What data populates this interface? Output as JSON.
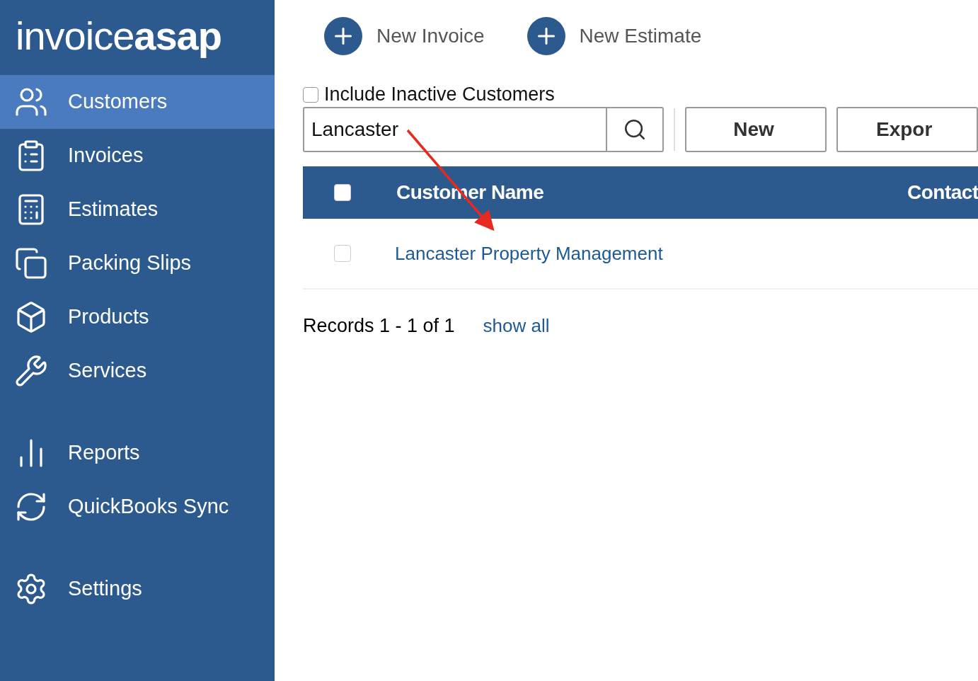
{
  "logo": {
    "light": "invoice",
    "bold": "asap"
  },
  "sidebar": {
    "sections": [
      {
        "items": [
          {
            "label": "Customers",
            "kind": "users",
            "selected": true
          },
          {
            "label": "Invoices",
            "kind": "clipboard",
            "selected": false
          },
          {
            "label": "Estimates",
            "kind": "calculator",
            "selected": false
          },
          {
            "label": "Packing Slips",
            "kind": "slips",
            "selected": false
          },
          {
            "label": "Products",
            "kind": "box",
            "selected": false
          },
          {
            "label": "Services",
            "kind": "wrench",
            "selected": false
          }
        ]
      },
      {
        "items": [
          {
            "label": "Reports",
            "kind": "chart",
            "selected": false
          },
          {
            "label": "QuickBooks Sync",
            "kind": "sync",
            "selected": false
          }
        ]
      },
      {
        "items": [
          {
            "label": "Settings",
            "kind": "gear",
            "selected": false
          }
        ]
      }
    ]
  },
  "actions": [
    "New Invoice",
    "New Estimate"
  ],
  "filter": {
    "label": "Include Inactive Customers",
    "checked": false
  },
  "search": {
    "value": "Lancaster"
  },
  "buttons": [
    "New",
    "Expor"
  ],
  "table": {
    "header_checked": false,
    "columns": [
      "Customer Name",
      "Contact"
    ],
    "rows": [
      {
        "name": "Lancaster Property Management",
        "checked": false
      }
    ]
  },
  "footer": {
    "records": "Records 1 - 1 of 1",
    "link": "show all"
  }
}
